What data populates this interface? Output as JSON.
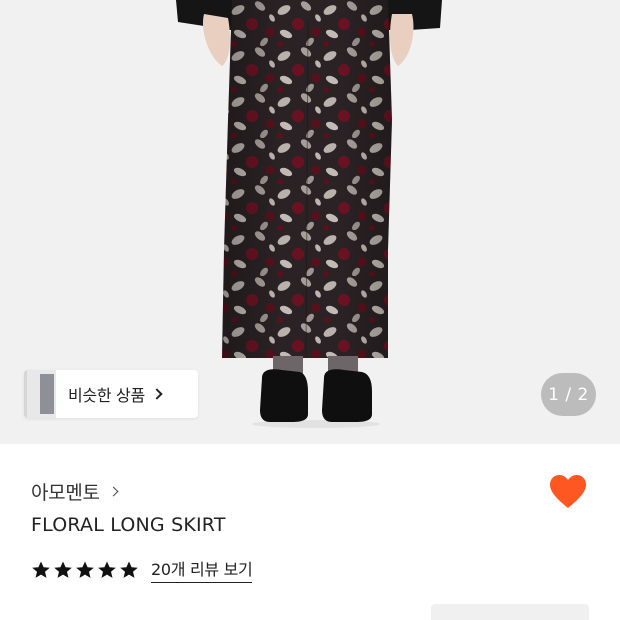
{
  "hero": {
    "similar_button": {
      "label": "비슷한 상품",
      "chevron_icon": "chevron-right-icon"
    },
    "pager": {
      "current": "1",
      "total": "2",
      "text": "1 / 2"
    }
  },
  "product": {
    "brand": "아모멘토",
    "brand_chevron_icon": "chevron-right-icon",
    "name": "FLORAL LONG SKIRT",
    "liked": true,
    "heart_icon": "heart-icon",
    "rating": {
      "stars": 5,
      "max": 5,
      "review_link": "20개 리뷰 보기"
    },
    "price": "​",
    "coupon_chip": "​"
  },
  "colors": {
    "heart": "#ff5722",
    "star": "#111111",
    "hero_bg": "#f1f1f1"
  }
}
